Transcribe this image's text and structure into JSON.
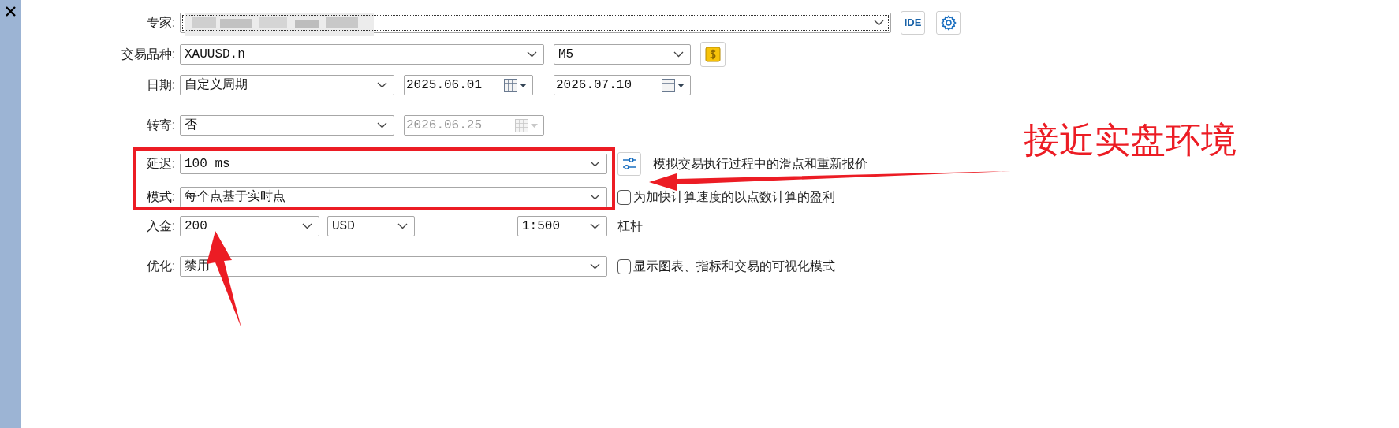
{
  "rows": [
    {
      "label": "专家:",
      "controls": [
        {
          "kind": "combo",
          "redacted": true
        },
        {
          "kind": "text-button",
          "label": "IDE"
        },
        {
          "kind": "settings-button"
        }
      ]
    },
    {
      "label": "交易品种:",
      "controls": [
        {
          "kind": "combo",
          "value": "XAUUSD.n"
        },
        {
          "kind": "combo",
          "value": "M5"
        },
        {
          "kind": "symbol-button"
        }
      ]
    },
    {
      "label": "日期:",
      "controls": [
        {
          "kind": "combo",
          "value": "自定义周期"
        },
        {
          "kind": "date",
          "value": "2025.06.01",
          "disabled": false
        },
        {
          "kind": "date",
          "value": "2026.07.10",
          "disabled": false
        }
      ]
    },
    {
      "label": "转寄:",
      "controls": [
        {
          "kind": "combo",
          "value": "否"
        },
        {
          "kind": "date",
          "value": "2026.06.25",
          "disabled": true
        }
      ]
    },
    {
      "label": "延迟:",
      "controls": [
        {
          "kind": "combo",
          "value": "100 ms"
        },
        {
          "kind": "tune-button"
        },
        {
          "kind": "text",
          "text": "模拟交易执行过程中的滑点和重新报价"
        }
      ]
    },
    {
      "label": "模式:",
      "controls": [
        {
          "kind": "combo",
          "value": "每个点基于实时点"
        },
        {
          "kind": "checkbox",
          "label": "为加快计算速度的以点数计算的盈利",
          "checked": false
        }
      ]
    },
    {
      "label": "入金:",
      "controls": [
        {
          "kind": "combo",
          "value": "200"
        },
        {
          "kind": "combo",
          "value": "USD"
        },
        {
          "kind": "combo",
          "value": "1:500"
        },
        {
          "kind": "text",
          "text": "杠杆"
        }
      ]
    },
    {
      "label": "优化:",
      "controls": [
        {
          "kind": "combo",
          "value": "禁用"
        },
        {
          "kind": "checkbox",
          "label": "显示图表、指标和交易的可视化模式",
          "checked": false
        }
      ]
    }
  ],
  "annotation": {
    "callout": "接近实盘环境"
  }
}
